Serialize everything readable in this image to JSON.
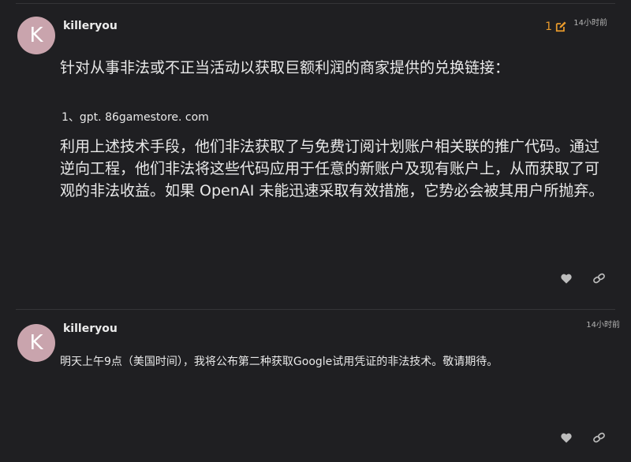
{
  "posts": [
    {
      "avatar_letter": "K",
      "username": "killeryou",
      "time": "14小时前",
      "edit_count": "1",
      "paragraphs": {
        "intro": "针对从事非法或不正当活动以获取巨额利润的商家提供的兑换链接：",
        "link": "1、gpt. 86gamestore. com",
        "desc": "利用上述技术手段，他们非法获取了与免费订阅计划账户相关联的推广代码。通过逆向工程，他们非法将这些代码应用于任意的新账户及现有账户上，从而获取了可观的非法收益。如果 OpenAI 未能迅速采取有效措施，它势必会被其用户所抛弃。"
      },
      "actions": [
        "heart-icon",
        "link-icon"
      ]
    },
    {
      "avatar_letter": "K",
      "username": "killeryou",
      "time": "14小时前",
      "paragraphs": {
        "text": "明天上午9点（美国时间），我将公布第二种获取Google试用凭证的非法技术。敬请期待。"
      },
      "actions": [
        "heart-icon",
        "link-icon"
      ]
    }
  ],
  "colors": {
    "background": "#1f1f22",
    "avatar": "#c9a4ad",
    "accent": "#e89a2c",
    "text": "#e9e9e9",
    "muted": "#b4b4b4"
  }
}
